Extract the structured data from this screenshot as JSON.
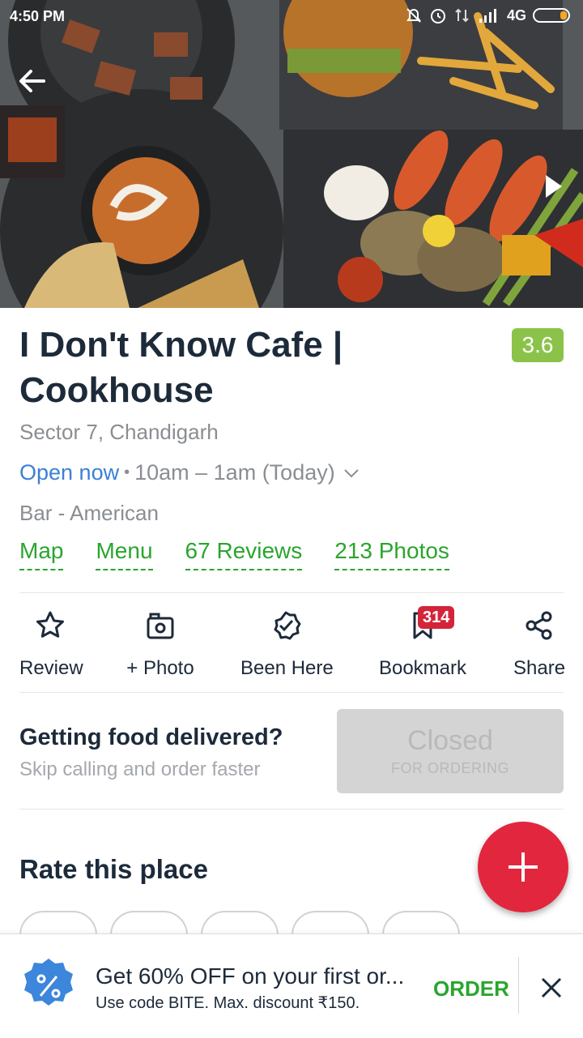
{
  "status_bar": {
    "time": "4:50 PM",
    "network": "4G"
  },
  "restaurant": {
    "name": "I Don't Know Cafe | Cookhouse",
    "rating": "3.6",
    "location": "Sector 7, Chandigarh",
    "open_status": "Open now",
    "hours": "10am – 1am (Today)",
    "cuisine": "Bar - American"
  },
  "links": [
    {
      "label": "Map"
    },
    {
      "label": "Menu"
    },
    {
      "label": "67 Reviews"
    },
    {
      "label": "213 Photos"
    }
  ],
  "actions": [
    {
      "label": "Review",
      "icon": "star-outline-icon"
    },
    {
      "label": "+ Photo",
      "icon": "camera-icon"
    },
    {
      "label": "Been Here",
      "icon": "check-badge-icon"
    },
    {
      "label": "Bookmark",
      "icon": "bookmark-icon"
    },
    {
      "label": "Share",
      "icon": "share-icon"
    }
  ],
  "bookmark_count": "314",
  "delivery": {
    "title": "Getting food delivered?",
    "subtitle": "Skip calling and order faster",
    "button_main": "Closed",
    "button_sub": "FOR ORDERING"
  },
  "rate": {
    "title": "Rate this place"
  },
  "promo": {
    "headline": "Get 60% OFF on your first or...",
    "subtext": "Use code BITE. Max. discount ₹150.",
    "cta": "ORDER"
  },
  "colors": {
    "accent_green": "#2aa52e",
    "rating_bg": "#8bc34a",
    "fab": "#e2263e",
    "link_blue": "#3c7fd6"
  }
}
